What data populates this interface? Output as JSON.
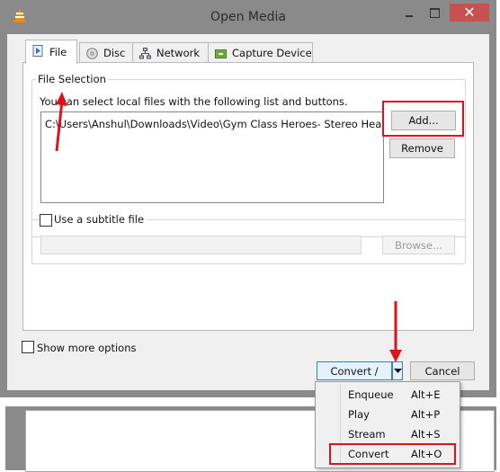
{
  "window": {
    "title": "Open Media",
    "close_glyph": "✕"
  },
  "tabs": [
    {
      "label": "File",
      "icon": "file-icon",
      "active": true
    },
    {
      "label": "Disc",
      "icon": "disc-icon",
      "active": false
    },
    {
      "label": "Network",
      "icon": "network-icon",
      "active": false
    },
    {
      "label": "Capture Device",
      "icon": "capture-device-icon",
      "active": false
    }
  ],
  "file_selection": {
    "title": "File Selection",
    "description": "You can select local files with the following list and buttons.",
    "files": [
      "C:\\Users\\Anshul\\Downloads\\Video\\Gym Class Heroes- Stereo Heart..."
    ],
    "add_label": "Add...",
    "remove_label": "Remove"
  },
  "subtitle": {
    "checkbox_label": "Use a subtitle file",
    "browse_label": "Browse..."
  },
  "options": {
    "show_more_label": "Show more options"
  },
  "footer": {
    "convert_save_label": "Convert / Save",
    "cancel_label": "Cancel"
  },
  "dropdown_menu": [
    {
      "label": "Enqueue",
      "shortcut": "Alt+E"
    },
    {
      "label": "Play",
      "shortcut": "Alt+P"
    },
    {
      "label": "Stream",
      "shortcut": "Alt+S"
    },
    {
      "label": "Convert",
      "shortcut": "Alt+O"
    }
  ],
  "colors": {
    "annotation_red": "#d9141e",
    "chrome_gray": "#8a8a8a",
    "close_red": "#c75050"
  }
}
